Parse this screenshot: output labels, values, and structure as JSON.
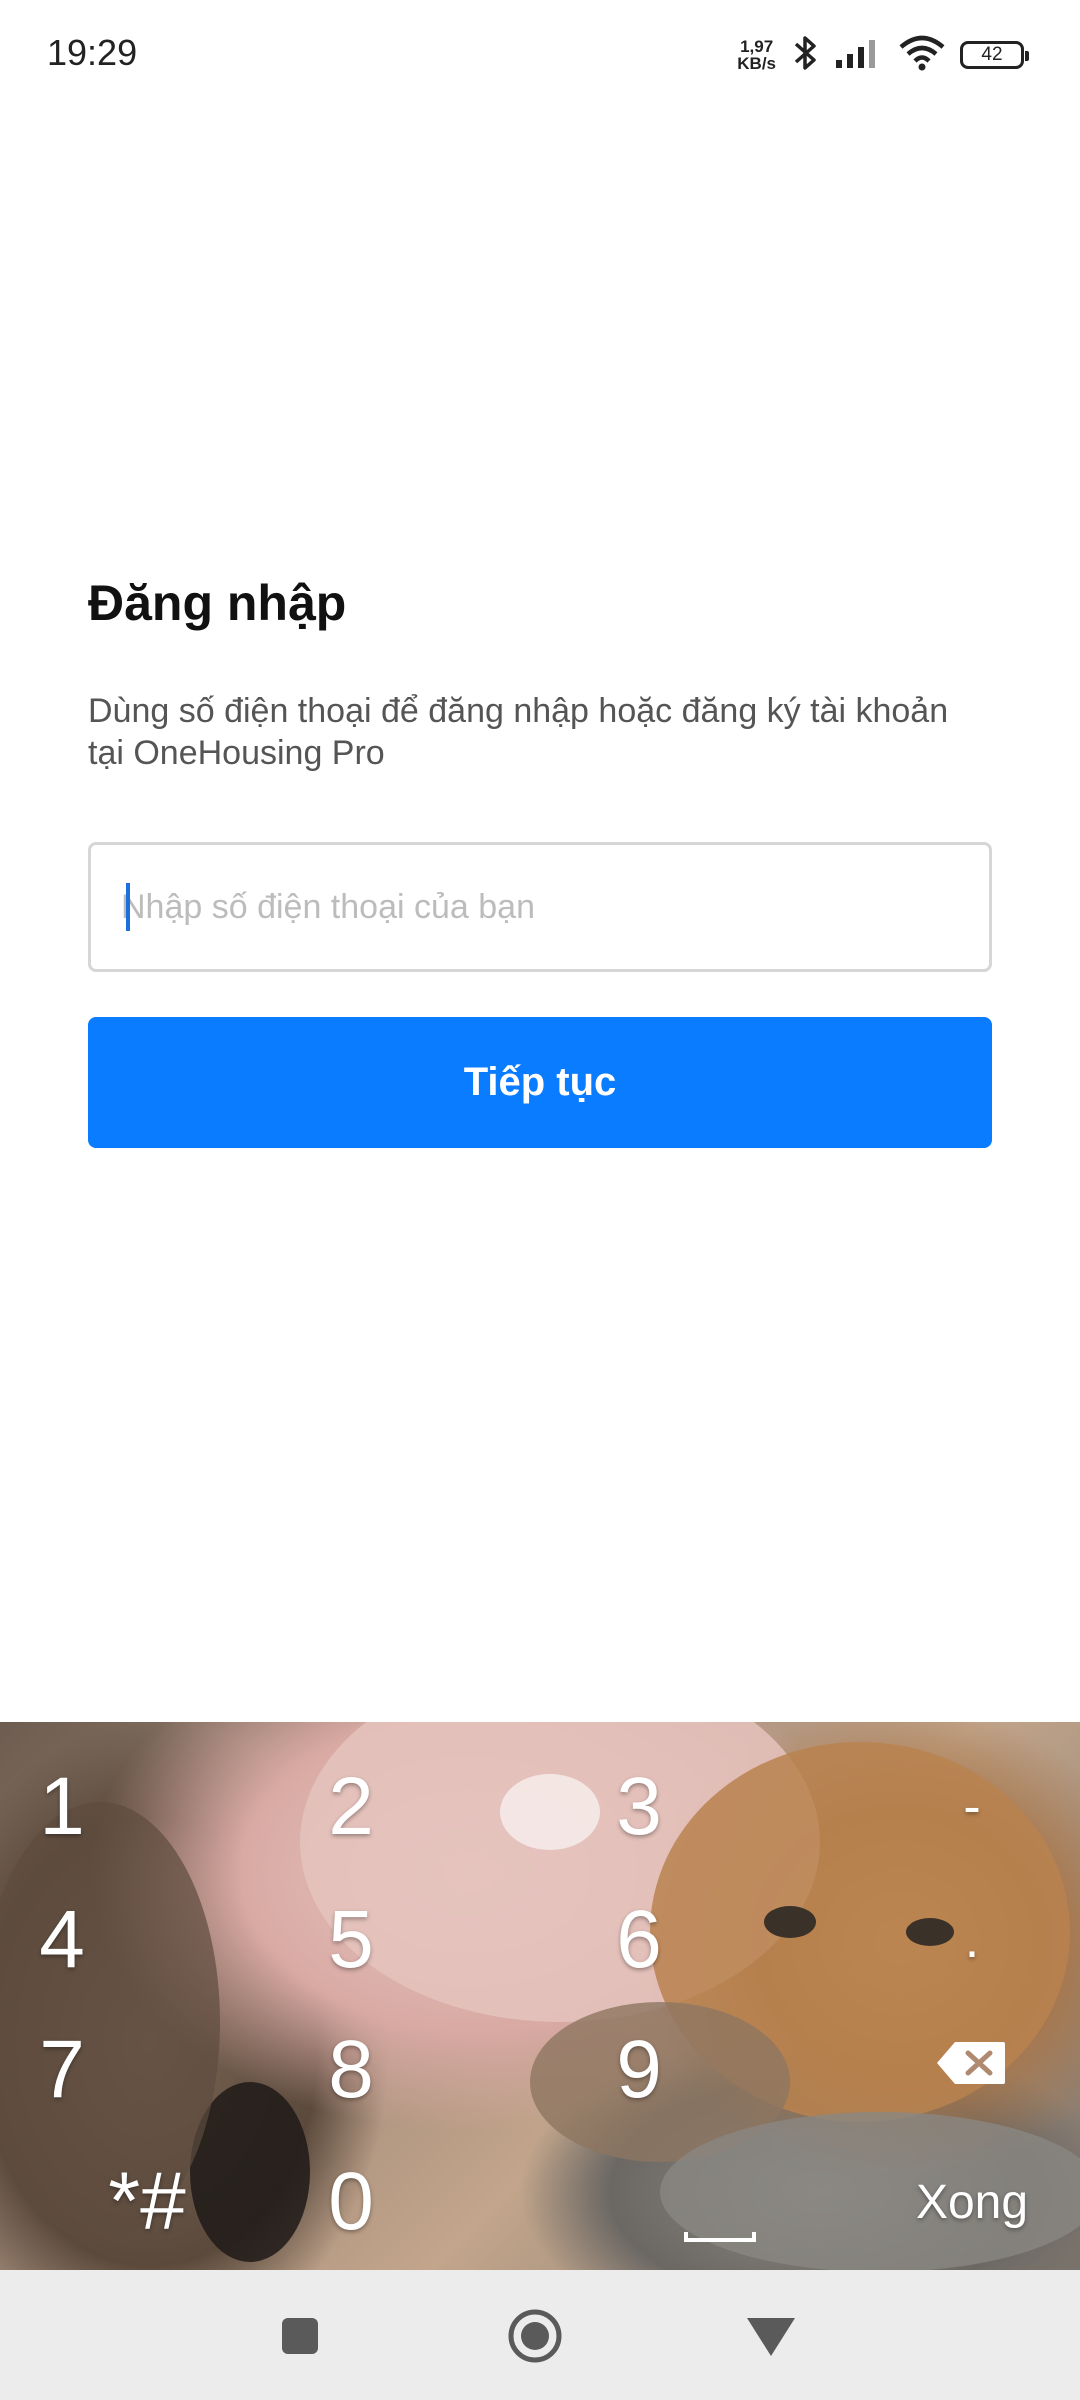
{
  "status_bar": {
    "time": "19:29",
    "net_speed_value": "1,97",
    "net_speed_unit": "KB/s",
    "battery": "42",
    "icons": [
      "bluetooth-icon",
      "signal-icon",
      "wifi-icon",
      "battery-icon"
    ]
  },
  "login": {
    "title": "Đăng nhập",
    "description": "Dùng số điện thoại để đăng nhập hoặc đăng ký tài khoản tại OneHousing Pro",
    "phone_placeholder": "Nhập số điện thoại của bạn",
    "phone_value": "",
    "continue_label": "Tiếp tục"
  },
  "keyboard": {
    "keys": [
      "1",
      "2",
      "3",
      "-",
      "4",
      "5",
      "6",
      ".",
      "7",
      "8",
      "9",
      "*#",
      "0"
    ],
    "done_label": "Xong",
    "icons": [
      "backspace-icon",
      "space-icon"
    ]
  },
  "nav_bar": {
    "icons": [
      "square-icon",
      "home-circle-icon",
      "back-triangle-icon"
    ]
  },
  "colors": {
    "primary": "#0a7cff",
    "text_secondary": "#555555",
    "input_border": "#d6d6d6",
    "placeholder": "#bcbcbc"
  }
}
